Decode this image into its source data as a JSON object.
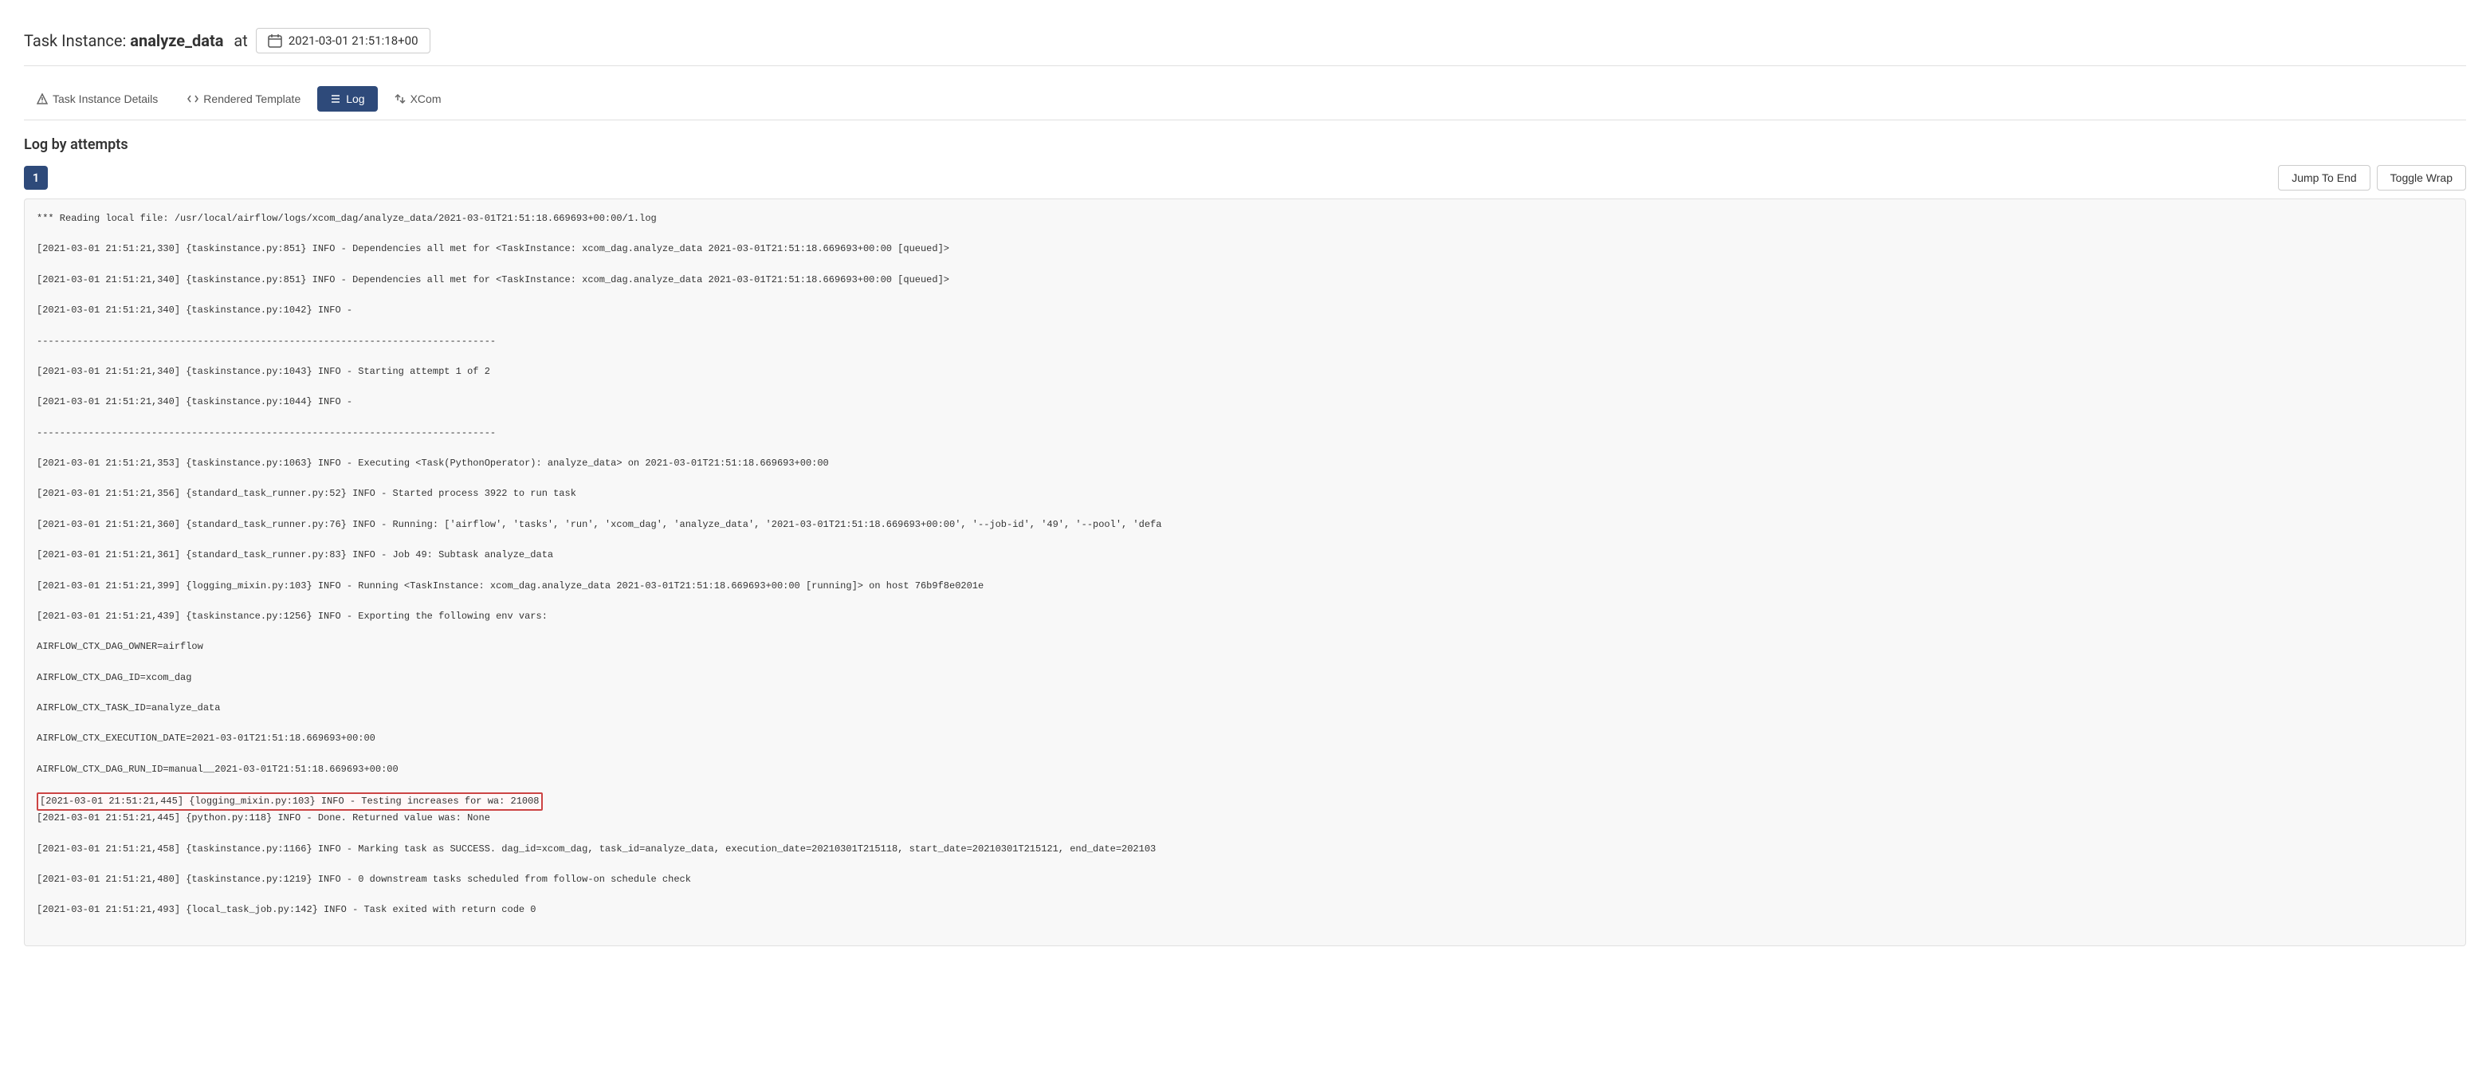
{
  "header": {
    "task_instance_label": "Task Instance:",
    "task_name": "analyze_data",
    "at_label": "at",
    "datetime": "2021-03-01 21:51:18+00",
    "calendar_icon": "calendar"
  },
  "nav": {
    "tabs": [
      {
        "id": "task-instance-details",
        "label": "Task Instance Details",
        "icon": "triangle-warning",
        "active": false
      },
      {
        "id": "rendered-template",
        "label": "Rendered Template",
        "icon": "code",
        "active": false
      },
      {
        "id": "log",
        "label": "Log",
        "icon": "list",
        "active": true
      },
      {
        "id": "xcom",
        "label": "XCom",
        "icon": "arrows",
        "active": false
      }
    ]
  },
  "log_section": {
    "title": "Log by attempts",
    "attempt_number": "1",
    "jump_to_end_label": "Jump To End",
    "toggle_wrap_label": "Toggle Wrap",
    "log_lines": [
      "*** Reading local file: /usr/local/airflow/logs/xcom_dag/analyze_data/2021-03-01T21:51:18.669693+00:00/1.log",
      "[2021-03-01 21:51:21,330] {taskinstance.py:851} INFO - Dependencies all met for <TaskInstance: xcom_dag.analyze_data 2021-03-01T21:51:18.669693+00:00 [queued]>",
      "[2021-03-01 21:51:21,340] {taskinstance.py:851} INFO - Dependencies all met for <TaskInstance: xcom_dag.analyze_data 2021-03-01T21:51:18.669693+00:00 [queued]>",
      "[2021-03-01 21:51:21,340] {taskinstance.py:1042} INFO -",
      "--------------------------------------------------------------------------------",
      "[2021-03-01 21:51:21,340] {taskinstance.py:1043} INFO - Starting attempt 1 of 2",
      "[2021-03-01 21:51:21,340] {taskinstance.py:1044} INFO -",
      "--------------------------------------------------------------------------------",
      "[2021-03-01 21:51:21,353] {taskinstance.py:1063} INFO - Executing <Task(PythonOperator): analyze_data> on 2021-03-01T21:51:18.669693+00:00",
      "[2021-03-01 21:51:21,356] {standard_task_runner.py:52} INFO - Started process 3922 to run task",
      "[2021-03-01 21:51:21,360] {standard_task_runner.py:76} INFO - Running: ['airflow', 'tasks', 'run', 'xcom_dag', 'analyze_data', '2021-03-01T21:51:18.669693+00:00', '--job-id', '49', '--pool', 'defa",
      "[2021-03-01 21:51:21,361] {standard_task_runner.py:83} INFO - Job 49: Subtask analyze_data",
      "[2021-03-01 21:51:21,399] {logging_mixin.py:103} INFO - Running <TaskInstance: xcom_dag.analyze_data 2021-03-01T21:51:18.669693+00:00 [running]> on host 76b9f8e0201e",
      "[2021-03-01 21:51:21,439] {taskinstance.py:1256} INFO - Exporting the following env vars:",
      "AIRFLOW_CTX_DAG_OWNER=airflow",
      "AIRFLOW_CTX_DAG_ID=xcom_dag",
      "AIRFLOW_CTX_TASK_ID=analyze_data",
      "AIRFLOW_CTX_EXECUTION_DATE=2021-03-01T21:51:18.669693+00:00",
      "AIRFLOW_CTX_DAG_RUN_ID=manual__2021-03-01T21:51:18.669693+00:00",
      "HIGHLIGHTED:[2021-03-01 21:51:21,445] {logging_mixin.py:103} INFO - Testing increases for wa: 21008",
      "[2021-03-01 21:51:21,445] {python.py:118} INFO - Done. Returned value was: None",
      "[2021-03-01 21:51:21,458] {taskinstance.py:1166} INFO - Marking task as SUCCESS. dag_id=xcom_dag, task_id=analyze_data, execution_date=20210301T215118, start_date=20210301T215121, end_date=202103",
      "[2021-03-01 21:51:21,480] {taskinstance.py:1219} INFO - 0 downstream tasks scheduled from follow-on schedule check",
      "[2021-03-01 21:51:21,493] {local_task_job.py:142} INFO - Task exited with return code 0"
    ]
  }
}
